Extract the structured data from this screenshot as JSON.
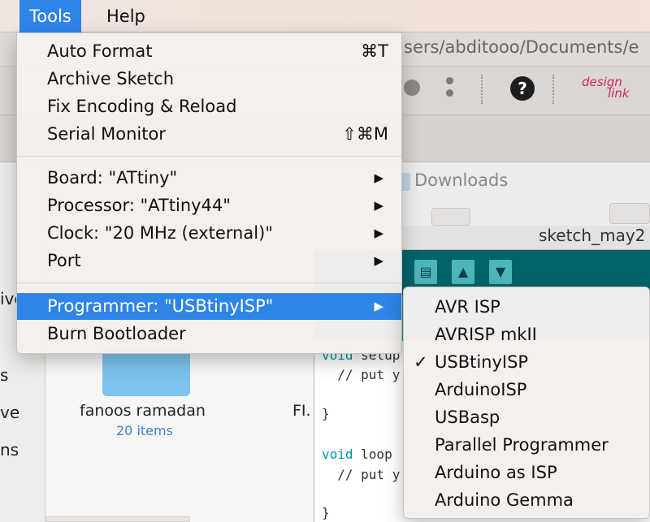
{
  "menubar": {
    "items": [
      {
        "label": "Tools",
        "active": true
      },
      {
        "label": "Help",
        "active": false
      }
    ]
  },
  "window": {
    "path_fragment": "sers/abditooo/Documents/e",
    "downloads_label": "Downloads",
    "sketch_title": "sketch_may2",
    "logo_text": "design link"
  },
  "finder": {
    "sidebar_fragments": [
      "ive",
      "s",
      "ve",
      "ns"
    ],
    "folder_name": "fanoos ramadan",
    "folder_count": "20 items",
    "file_fragment": "FI."
  },
  "code": {
    "line1_kw": "void",
    "line1_rest": " setup",
    "line2": "  // put y",
    "line3": "}",
    "line4_kw": "void",
    "line4_rest": " loop",
    "line5": "  // put y",
    "line6": "}"
  },
  "tools_menu": {
    "group1": [
      {
        "label": "Auto Format",
        "shortcut": "⌘T"
      },
      {
        "label": "Archive Sketch",
        "shortcut": ""
      },
      {
        "label": "Fix Encoding & Reload",
        "shortcut": ""
      },
      {
        "label": "Serial Monitor",
        "shortcut": "⇧⌘M"
      }
    ],
    "group2": [
      {
        "label": "Board: \"ATtiny\"",
        "arrow": "▶"
      },
      {
        "label": "Processor: \"ATtiny44\"",
        "arrow": "▶"
      },
      {
        "label": "Clock: \"20 MHz (external)\"",
        "arrow": "▶"
      },
      {
        "label": "Port",
        "arrow": "▶"
      }
    ],
    "group3": [
      {
        "label": "Programmer: \"USBtinyISP\"",
        "arrow": "▶",
        "highlighted": true
      },
      {
        "label": "Burn Bootloader",
        "arrow": ""
      }
    ]
  },
  "programmer_submenu": {
    "items": [
      {
        "label": "AVR ISP",
        "checked": false
      },
      {
        "label": "AVRISP mkII",
        "checked": false
      },
      {
        "label": "USBtinyISP",
        "checked": true,
        "check": "✓"
      },
      {
        "label": "ArduinoISP",
        "checked": false
      },
      {
        "label": "USBasp",
        "checked": false
      },
      {
        "label": "Parallel Programmer",
        "checked": false
      },
      {
        "label": "Arduino as ISP",
        "checked": false
      },
      {
        "label": "Arduino Gemma",
        "checked": false
      }
    ]
  },
  "colors": {
    "highlight": "#2f84e8",
    "arduino_teal": "#006468",
    "arduino_tab": "#17a1a5"
  }
}
